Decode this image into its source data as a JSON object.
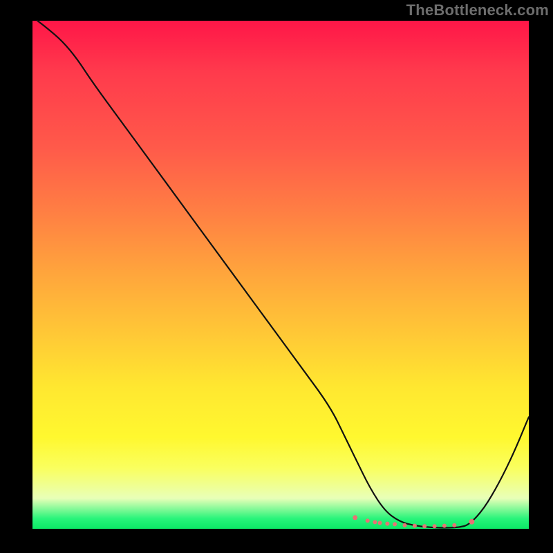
{
  "watermark": "TheBottleneck.com",
  "colors": {
    "page_bg": "#000000",
    "gradient_top": "#ff1648",
    "gradient_bottom": "#0ce866",
    "curve": "#111111",
    "markers": "#e77374"
  },
  "chart_data": {
    "type": "line",
    "title": "",
    "xlabel": "",
    "ylabel": "",
    "xlim": [
      0,
      100
    ],
    "ylim": [
      0,
      100
    ],
    "x": [
      1,
      3,
      6,
      9,
      12,
      18,
      24,
      30,
      36,
      42,
      48,
      54,
      60,
      63,
      65,
      68,
      71,
      74,
      77,
      80,
      82,
      84,
      86,
      88,
      91,
      94,
      97,
      100
    ],
    "values": [
      100,
      98.5,
      96,
      92.5,
      88,
      80,
      72,
      64,
      56,
      48,
      40,
      32,
      24,
      18,
      14,
      8,
      3.5,
      1.4,
      0.6,
      0.3,
      0.2,
      0.2,
      0.3,
      0.8,
      4,
      9,
      15,
      22
    ],
    "markers": {
      "x": [
        65,
        67.5,
        69,
        70,
        71.5,
        73,
        75,
        77,
        79,
        81,
        83,
        85,
        88.5
      ],
      "values": [
        2.2,
        1.6,
        1.3,
        1.15,
        1.0,
        0.9,
        0.7,
        0.6,
        0.5,
        0.5,
        0.6,
        0.7,
        1.4
      ],
      "size": [
        7,
        6,
        6,
        6,
        6,
        6,
        6,
        6,
        6,
        6,
        6,
        6,
        8
      ]
    }
  }
}
